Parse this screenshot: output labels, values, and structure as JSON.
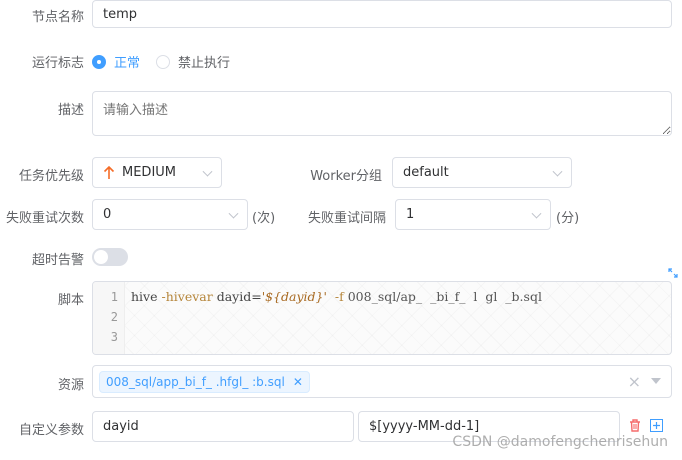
{
  "form": {
    "node_name": {
      "label": "节点名称",
      "value": "temp"
    },
    "run_flag": {
      "label": "运行标志",
      "options": [
        "正常",
        "禁止执行"
      ],
      "selected": "正常"
    },
    "description": {
      "label": "描述",
      "placeholder": "请输入描述"
    },
    "priority": {
      "label": "任务优先级",
      "value": "MEDIUM",
      "color": "#f56c27"
    },
    "worker_group": {
      "label": "Worker分组",
      "value": "default"
    },
    "retry_count": {
      "label": "失败重试次数",
      "value": "0",
      "unit": "(次)"
    },
    "retry_interval": {
      "label": "失败重试间隔",
      "value": "1",
      "unit": "(分)"
    },
    "timeout_alarm": {
      "label": "超时告警",
      "enabled": false
    },
    "script": {
      "label": "脚本",
      "line_numbers": [
        "1",
        "2",
        "3"
      ],
      "line1": {
        "cmd": "hive ",
        "flag": "-hivevar",
        "var": " dayid=",
        "str": "'${dayid}'",
        "flag2": "  -f",
        "path": " 008_sql/ap_  _bi_f_  l  gl  _b.sql"
      }
    },
    "resources": {
      "label": "资源",
      "tags": [
        "008_sql/app_bi_f_  .hfgl_  :b.sql"
      ],
      "clear_icon": "×"
    },
    "custom_params": {
      "label": "自定义参数",
      "key": "dayid",
      "value": "$[yyyy-MM-dd-1]"
    }
  },
  "watermark": "CSDN @damofengchenrisehun",
  "colors": {
    "accent": "#409eff",
    "danger": "#f56c6c",
    "priority_arrow": "#f56c27"
  }
}
